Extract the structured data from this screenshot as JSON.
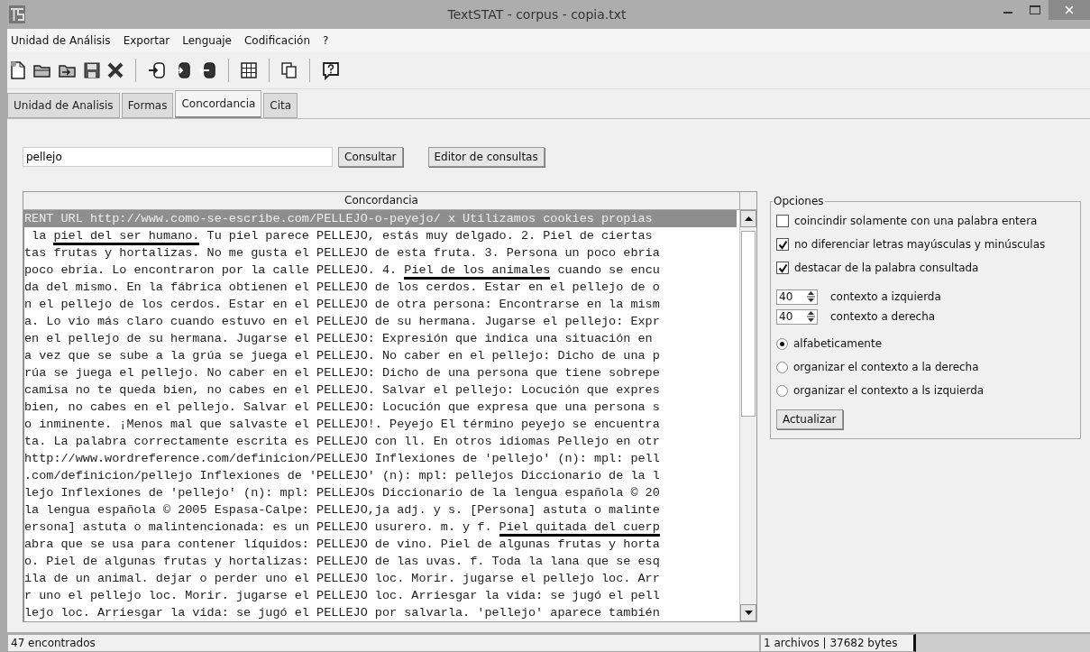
{
  "window": {
    "title": "TextSTAT - corpus - copia.txt"
  },
  "menu": [
    "Unidad de Análisis",
    "Exportar",
    "Lenguaje",
    "Codificación",
    "?"
  ],
  "tabs": [
    {
      "label": "Unidad de Analisis",
      "selected": false
    },
    {
      "label": "Formas",
      "selected": false
    },
    {
      "label": "Concordancia",
      "selected": true
    },
    {
      "label": "Cita",
      "selected": false
    }
  ],
  "query": {
    "value": "pellejo"
  },
  "buttons": [
    "Consultar",
    "Editor de consultas"
  ],
  "table": {
    "column": "Concordancia",
    "rows": [
      {
        "selected": true,
        "segments": [
          {
            "text": "RENT URL http://www.como-se-escribe.com/PELLEJO-o-peyejo/ x Utilizamos cookies propias",
            "underlined": false
          }
        ]
      },
      {
        "selected": false,
        "segments": [
          {
            "text": " la ",
            "underlined": false
          },
          {
            "text": "piel del ser humano.",
            "underlined": true
          },
          {
            "text": " Tu piel parece PELLEJO, estás muy delgado. 2. Piel de ciertas",
            "underlined": false
          }
        ]
      },
      {
        "selected": false,
        "segments": [
          {
            "text": "tas frutas y hortalizas. No me gusta el PELLEJO de esta fruta. 3. Persona un poco ebria",
            "underlined": false
          }
        ]
      },
      {
        "selected": false,
        "segments": [
          {
            "text": "poco ebria. Lo encontraron por la calle PELLEJO. 4. ",
            "underlined": false
          },
          {
            "text": "Piel de los animales",
            "underlined": true
          },
          {
            "text": " cuando se encu",
            "underlined": false
          }
        ]
      },
      {
        "selected": false,
        "segments": [
          {
            "text": "da del mismo. En la fábrica obtienen el PELLEJO de los cerdos. Estar en el pellejo de o",
            "underlined": false
          }
        ]
      },
      {
        "selected": false,
        "segments": [
          {
            "text": "n el pellejo de los cerdos. Estar en el PELLEJO de otra persona: Encontrarse en la mism",
            "underlined": false
          }
        ]
      },
      {
        "selected": false,
        "segments": [
          {
            "text": "a. Lo vio más claro cuando estuvo en el PELLEJO de su hermana. Jugarse el pellejo: Expr",
            "underlined": false
          }
        ]
      },
      {
        "selected": false,
        "segments": [
          {
            "text": "en el pellejo de su hermana. Jugarse el PELLEJO: Expresión que indica una situación en",
            "underlined": false
          }
        ]
      },
      {
        "selected": false,
        "segments": [
          {
            "text": "a vez que se sube a la grúa se juega el PELLEJO. No caber en el pellejo: Dicho de una p",
            "underlined": false
          }
        ]
      },
      {
        "selected": false,
        "segments": [
          {
            "text": "rúa se juega el pellejo. No caber en el PELLEJO: Dicho de una persona que tiene sobrepe",
            "underlined": false
          }
        ]
      },
      {
        "selected": false,
        "segments": [
          {
            "text": "camisa no te queda bien, no cabes en el PELLEJO. Salvar el pellejo: Locución que expres",
            "underlined": false
          }
        ]
      },
      {
        "selected": false,
        "segments": [
          {
            "text": "bien, no cabes en el pellejo. Salvar el PELLEJO: Locución que expresa que una persona s",
            "underlined": false
          }
        ]
      },
      {
        "selected": false,
        "segments": [
          {
            "text": "o inminente. ¡Menos mal que salvaste el PELLEJO!. Peyejo El término peyejo se encuentra",
            "underlined": false
          }
        ]
      },
      {
        "selected": false,
        "segments": [
          {
            "text": "ta. La palabra correctamente escrita es PELLEJO con ll. En otros idiomas Pellejo en otr",
            "underlined": false
          }
        ]
      },
      {
        "selected": false,
        "segments": [
          {
            "text": "http://www.wordreference.com/definicion/PELLEJO Inflexiones de 'pellejo' (n): mpl: pell",
            "underlined": false
          }
        ]
      },
      {
        "selected": false,
        "segments": [
          {
            "text": ".com/definicion/pellejo Inflexiones de 'PELLEJO' (n): mpl: pellejos Diccionario de la l",
            "underlined": false
          }
        ]
      },
      {
        "selected": false,
        "segments": [
          {
            "text": "lejo Inflexiones de 'pellejo' (n): mpl: PELLEJOs Diccionario de la lengua española © 20",
            "underlined": false
          }
        ]
      },
      {
        "selected": false,
        "segments": [
          {
            "text": "la lengua española © 2005 Espasa-Calpe: PELLEJO,ja adj. y s. [Persona] astuta o malinte",
            "underlined": false
          }
        ]
      },
      {
        "selected": false,
        "segments": [
          {
            "text": "ersona] astuta o malintencionada: es un PELLEJO usurero. m. y f. ",
            "underlined": false
          },
          {
            "text": "Piel quitada del cuerp",
            "underlined": true
          }
        ]
      },
      {
        "selected": false,
        "segments": [
          {
            "text": "abra que se usa para contener líquidos: PELLEJO de vino. Piel de algunas frutas y horta",
            "underlined": false
          }
        ]
      },
      {
        "selected": false,
        "segments": [
          {
            "text": "o. Piel de algunas frutas y hortalizas: PELLEJO de las uvas. f. Toda la lana que se esq",
            "underlined": false
          }
        ]
      },
      {
        "selected": false,
        "segments": [
          {
            "text": "ila de un animal. dejar o perder uno el PELLEJO loc. Morir. jugarse el pellejo loc. Arr",
            "underlined": false
          }
        ]
      },
      {
        "selected": false,
        "segments": [
          {
            "text": "r uno el pellejo loc. Morir. jugarse el PELLEJO loc. Arriesgar la vida: se jugó el pell",
            "underlined": false
          }
        ]
      },
      {
        "selected": false,
        "segments": [
          {
            "text": "lejo loc. Arriesgar la vida: se jugó el PELLEJO por salvarla. 'pellejo' aparece también",
            "underlined": false
          }
        ]
      }
    ]
  },
  "options": {
    "title": "Opciones",
    "checkboxes": [
      {
        "label": "coincindir solamente con una palabra entera",
        "checked": false
      },
      {
        "label": "no diferenciar letras mayúsculas y minúsculas",
        "checked": true
      },
      {
        "label": "destacar de la palabra consultada",
        "checked": true
      }
    ],
    "spinners": [
      {
        "value": "40",
        "label": "contexto a izquierda"
      },
      {
        "value": "40",
        "label": "contexto a derecha"
      }
    ],
    "sort": [
      {
        "label": "alfabeticamente",
        "selected": true
      },
      {
        "label": "organizar el contexto a la derecha",
        "selected": false
      },
      {
        "label": "organizar el contexto a ls izquierda",
        "selected": false
      }
    ],
    "button": "Actualizar"
  },
  "status_bar": {
    "found": "47 encontrados",
    "files": "1 archivos | 37682 bytes"
  }
}
